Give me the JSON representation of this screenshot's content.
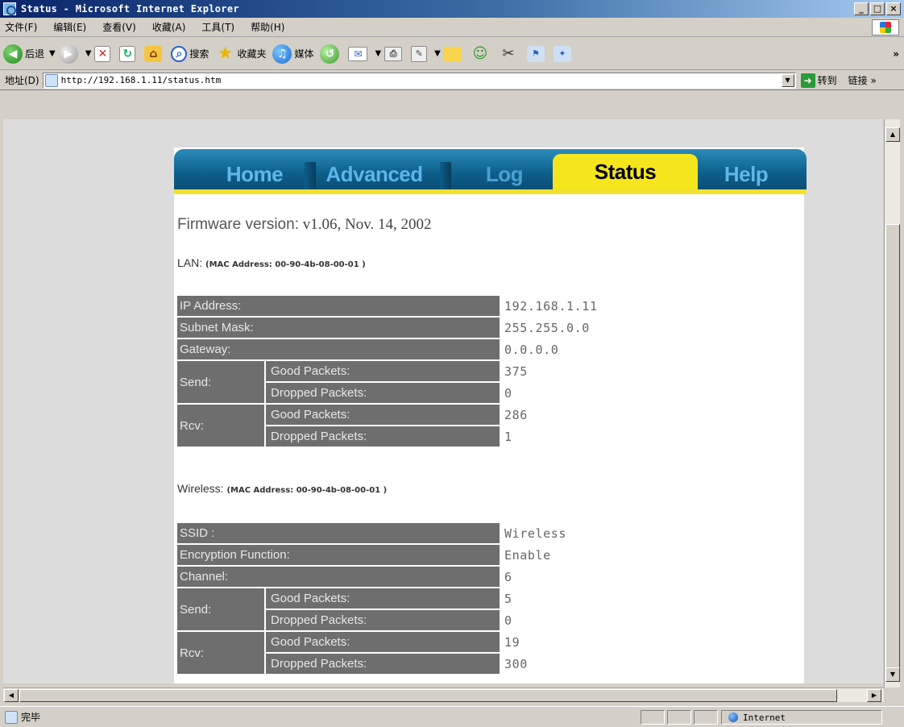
{
  "window": {
    "title": "Status - Microsoft Internet Explorer",
    "buttons": [
      "_",
      "□",
      "×"
    ]
  },
  "menu": [
    "文件(F)",
    "编辑(E)",
    "查看(V)",
    "收藏(A)",
    "工具(T)",
    "帮助(H)"
  ],
  "toolbar": {
    "back_label": "后退",
    "search_label": "搜索",
    "favorites_label": "收藏夹",
    "media_label": "媒体",
    "more": "»"
  },
  "address": {
    "label": "地址(D)",
    "url": "http://192.168.1.11/status.htm",
    "go_label": "转到",
    "links_label": "链接 »"
  },
  "nav": {
    "home": "Home",
    "advanced": "Advanced",
    "log": "Log",
    "status": "Status",
    "help": "Help"
  },
  "firmware": {
    "label": "Firmware version:",
    "value": "v1.06, Nov. 14, 2002"
  },
  "lan": {
    "label": "LAN:",
    "mac": "(MAC Address: 00-90-4b-08-00-01 )",
    "rows": {
      "ip_label": "IP Address:",
      "ip": "192.168.1.11",
      "mask_label": "Subnet Mask:",
      "mask": "255.255.0.0",
      "gw_label": "Gateway:",
      "gw": "0.0.0.0",
      "send_label": "Send:",
      "rcv_label": "Rcv:",
      "good_label": "Good Packets:",
      "dropped_label": "Dropped Packets:",
      "send_good": "375",
      "send_dropped": "0",
      "rcv_good": "286",
      "rcv_dropped": "1"
    }
  },
  "wireless": {
    "label": "Wireless:",
    "mac": "(MAC Address: 00-90-4b-08-00-01 )",
    "rows": {
      "ssid_label": "SSID :",
      "ssid": "Wireless",
      "enc_label": "Encryption Function:",
      "enc": "Enable",
      "channel_label": "Channel:",
      "channel": "6",
      "send_label": "Send:",
      "rcv_label": "Rcv:",
      "good_label": "Good Packets:",
      "dropped_label": "Dropped Packets:",
      "send_good": "5",
      "send_dropped": "0",
      "rcv_good": "19",
      "rcv_dropped": "300"
    }
  },
  "statusbar": {
    "text": "完毕",
    "zone": "Internet"
  }
}
